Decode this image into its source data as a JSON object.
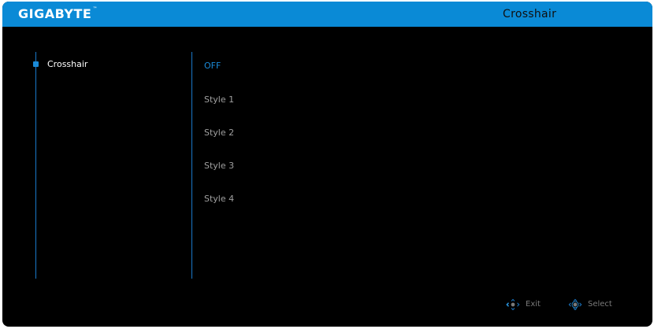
{
  "header": {
    "brand": "GIGABYTE",
    "brand_tm": "™",
    "title": "Crosshair"
  },
  "menu": {
    "items": [
      {
        "label": "Crosshair",
        "active": true
      }
    ]
  },
  "options": [
    {
      "label": "OFF",
      "selected": true
    },
    {
      "label": "Style 1",
      "selected": false
    },
    {
      "label": "Style 2",
      "selected": false
    },
    {
      "label": "Style 3",
      "selected": false
    },
    {
      "label": "Style 4",
      "selected": false
    }
  ],
  "footer": {
    "exit_label": "Exit",
    "exit_icon": "joystick-left-icon",
    "select_label": "Select",
    "select_icon": "joystick-press-icon"
  },
  "colors": {
    "accent": "#0a8ad6",
    "background": "#000000",
    "text": "#ffffff",
    "muted": "#a0a0a0"
  }
}
